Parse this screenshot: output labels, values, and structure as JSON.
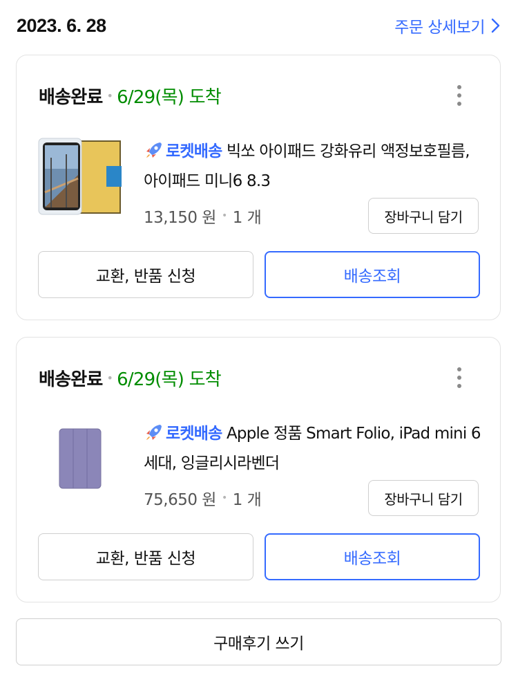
{
  "order": {
    "date": "2023. 6. 28",
    "detail_link": "주문 상세보기"
  },
  "items": [
    {
      "status": "배송완료",
      "arrival": "6/29(목) 도착",
      "badge": "로켓배송",
      "name": "빅쏘 아이패드 강화유리 액정보호필름, 아이패드 미니6 8.3",
      "price": "13,150 원",
      "quantity": "1 개",
      "cart_label": "장바구니 담기",
      "exchange_label": "교환, 반품 신청",
      "track_label": "배송조회"
    },
    {
      "status": "배송완료",
      "arrival": "6/29(목) 도착",
      "badge": "로켓배송",
      "name": "Apple 정품 Smart Folio, iPad mini 6세대, 잉글리시라벤더",
      "price": "75,650 원",
      "quantity": "1 개",
      "cart_label": "장바구니 담기",
      "exchange_label": "교환, 반품 신청",
      "track_label": "배송조회"
    }
  ],
  "review_button": "구매후기 쓰기",
  "icons": {
    "detail_arrow": "chevron-right-icon",
    "more": "more-vertical-icon",
    "rocket": "rocket-icon"
  },
  "colors": {
    "accent": "#346aff",
    "arrival": "#008c00",
    "muted": "#555555",
    "border": "#cfcfcf"
  }
}
